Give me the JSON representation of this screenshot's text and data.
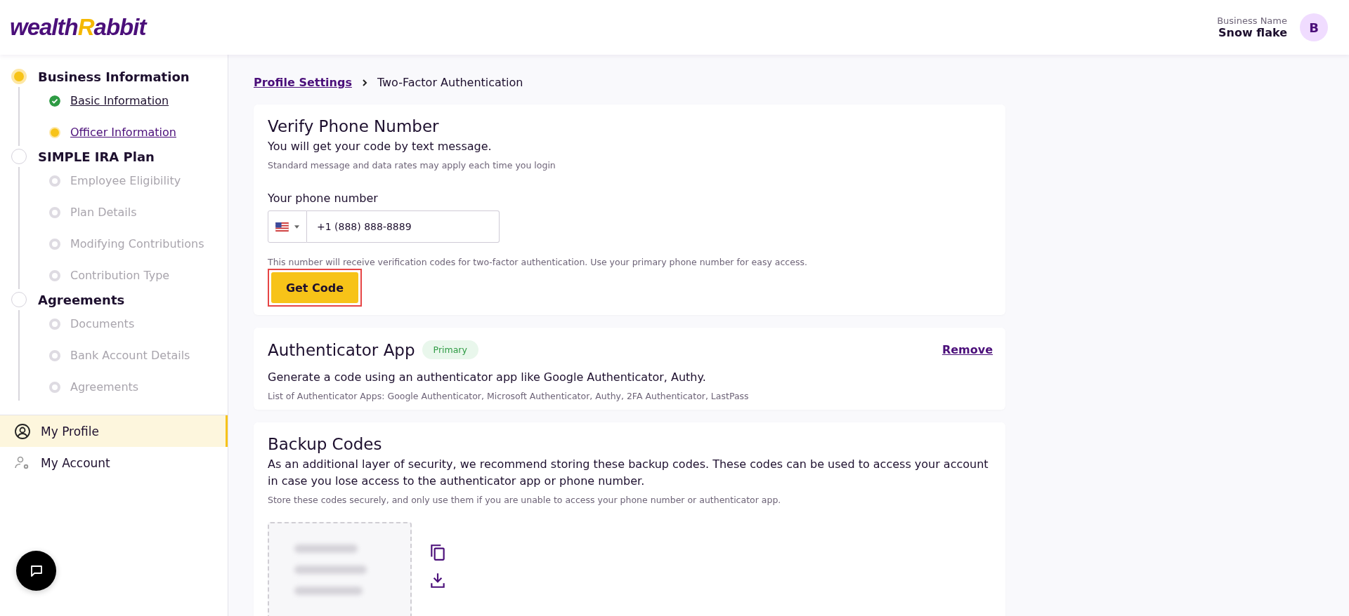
{
  "header": {
    "logo": [
      "wealth",
      "R",
      "abbit"
    ],
    "business_label": "Business Name",
    "business_name": "Snow flake",
    "avatar": "B"
  },
  "sidebar": {
    "sections": [
      {
        "title": "Business Information",
        "active": true,
        "items": [
          {
            "label": "Basic Information",
            "completed": true,
            "current": false,
            "disabled": false
          },
          {
            "label": "Officer Information",
            "completed": false,
            "current": true,
            "disabled": false
          }
        ]
      },
      {
        "title": "SIMPLE IRA Plan",
        "active": false,
        "items": [
          {
            "label": "Employee Eligibility",
            "completed": false,
            "current": false,
            "disabled": true
          },
          {
            "label": "Plan Details",
            "completed": false,
            "current": false,
            "disabled": true
          },
          {
            "label": "Modifying Contributions",
            "completed": false,
            "current": false,
            "disabled": true
          },
          {
            "label": "Contribution Type",
            "completed": false,
            "current": false,
            "disabled": true
          }
        ]
      },
      {
        "title": "Agreements",
        "active": false,
        "items": [
          {
            "label": "Documents",
            "completed": false,
            "current": false,
            "disabled": true
          },
          {
            "label": "Bank Account Details",
            "completed": false,
            "current": false,
            "disabled": true
          },
          {
            "label": "Agreements",
            "completed": false,
            "current": false,
            "disabled": true
          }
        ]
      }
    ],
    "nav": [
      {
        "label": "My Profile",
        "kind": "profile",
        "selected": true
      },
      {
        "label": "My Account",
        "kind": "account",
        "selected": false
      }
    ]
  },
  "breadcrumb": {
    "link": "Profile Settings",
    "current": "Two-Factor Authentication"
  },
  "verify_phone": {
    "title": "Verify Phone Number",
    "subtitle": "You will get your code by text message.",
    "note": "Standard message and data rates may apply each time you login",
    "field_label": "Your phone number",
    "phone": "+1 (888) 888-8889",
    "hint": "This number will receive verification codes for two-factor authentication. Use your primary phone number for easy access.",
    "button": "Get Code",
    "button_highlighted": true
  },
  "authenticator": {
    "title": "Authenticator App",
    "badge": "Primary",
    "action": "Remove",
    "description": "Generate a code using an authenticator app like Google Authenticator, Authy.",
    "note": "List of Authenticator Apps: Google Authenticator, Microsoft Authenticator, Authy, 2FA Authenticator, LastPass"
  },
  "backup": {
    "title": "Backup Codes",
    "description": "As an additional layer of security, we recommend storing these backup codes. These codes can be used to access your account in case you lose access to the authenticator app or phone number.",
    "note": "Store these codes securely, and only use them if you are unable to access your phone number or authenticator app."
  }
}
